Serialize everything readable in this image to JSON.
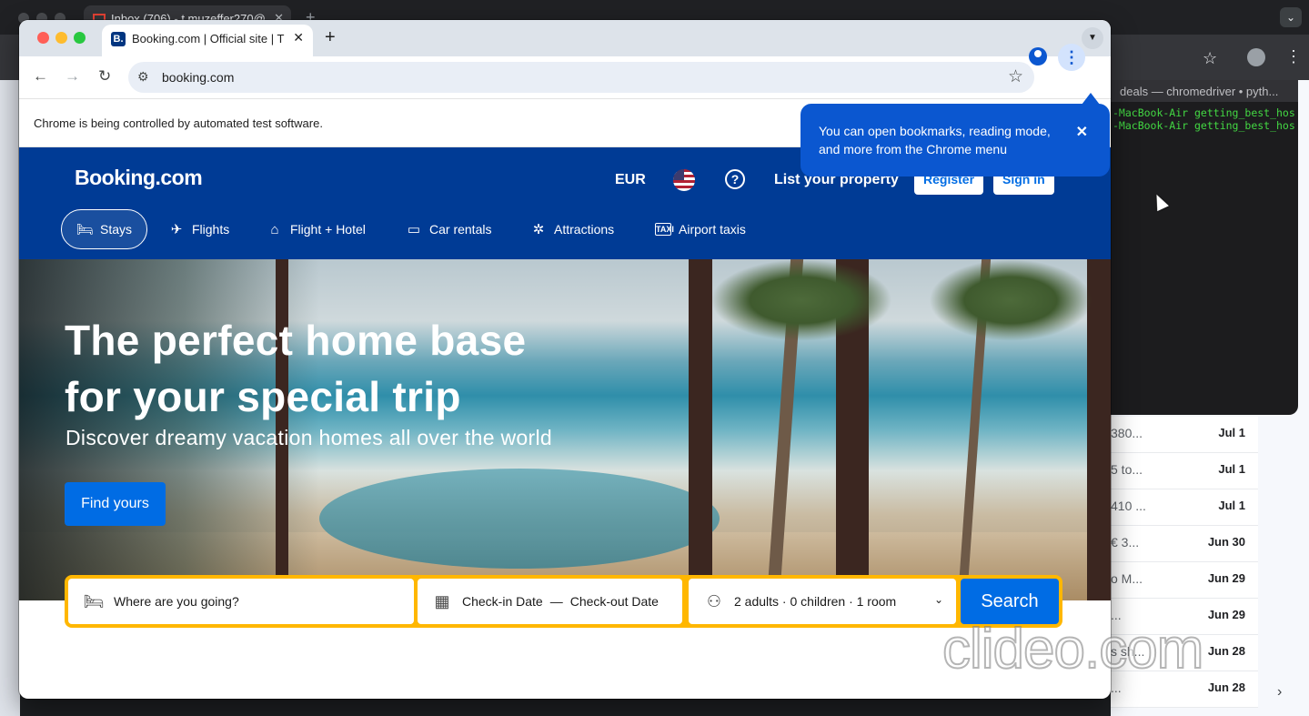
{
  "background": {
    "tab_title": "Inbox (706) - t.muzeffer270@...",
    "terminal": {
      "title": "deals — chromedriver • pyth...",
      "lines": [
        "-MacBook-Air getting_best_hos",
        "-MacBook-Air getting_best_hos"
      ]
    },
    "mail_rows": [
      {
        "snippet": "380...",
        "date": "Jul 1"
      },
      {
        "snippet": "5 to...",
        "date": "Jul 1"
      },
      {
        "snippet": "410 ...",
        "date": "Jul 1"
      },
      {
        "snippet": "€ 3...",
        "date": "Jun 30"
      },
      {
        "snippet": "o M...",
        "date": "Jun 29"
      },
      {
        "snippet": "...",
        "date": "Jun 29"
      },
      {
        "snippet": "s sh...",
        "date": "Jun 28"
      },
      {
        "snippet": "...",
        "date": "Jun 28"
      }
    ]
  },
  "browser": {
    "tab_title": "Booking.com | Official site | T",
    "url": "booking.com",
    "automation_notice": "Chrome is being controlled by automated test software.",
    "menu_tooltip": "You can open bookmarks, reading mode, and more from the Chrome menu"
  },
  "booking": {
    "logo": "Booking.com",
    "currency": "EUR",
    "help_glyph": "?",
    "list_property": "List your property",
    "register": "Register",
    "sign_in": "Sign in",
    "nav": [
      {
        "label": "Stays",
        "icon": "bed-icon"
      },
      {
        "label": "Flights",
        "icon": "plane-icon"
      },
      {
        "label": "Flight + Hotel",
        "icon": "flight-hotel-icon"
      },
      {
        "label": "Car rentals",
        "icon": "car-icon"
      },
      {
        "label": "Attractions",
        "icon": "attractions-icon"
      },
      {
        "label": "Airport taxis",
        "icon": "taxi-icon"
      }
    ],
    "hero": {
      "title_line1": "The perfect home base",
      "title_line2": "for your special trip",
      "subtitle": "Discover dreamy vacation homes all over the world",
      "cta": "Find yours"
    },
    "search": {
      "destination_placeholder": "Where are you going?",
      "checkin": "Check-in Date",
      "date_separator": "—",
      "checkout": "Check-out Date",
      "guests": "2 adults · 0 children · 1 room",
      "button": "Search"
    }
  },
  "watermark": "clideo.com",
  "colors": {
    "booking_blue": "#003b95",
    "booking_action": "#006ce4",
    "booking_yellow": "#ffb700",
    "chrome_tooltip": "#0b57d0"
  }
}
